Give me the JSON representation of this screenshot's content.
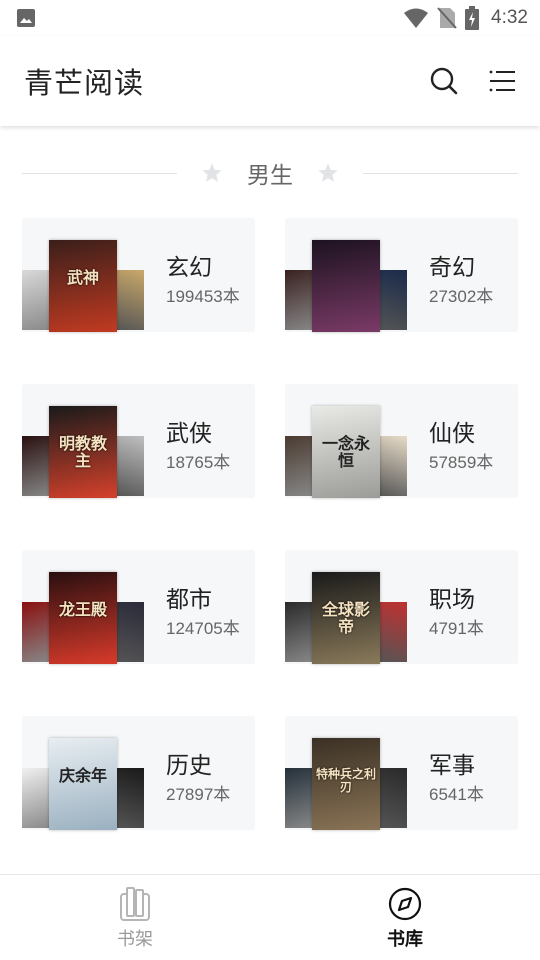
{
  "status_bar": {
    "time": "4:32"
  },
  "app": {
    "title": "青芒阅读"
  },
  "section": {
    "title": "男生"
  },
  "categories": [
    {
      "name": "玄幻",
      "count": "199453本",
      "cover_text": "武神",
      "cover_colors": [
        "#3a1f1a",
        "#c23a21"
      ],
      "side_colors": [
        "#d9d9d9",
        "#c9a86a"
      ]
    },
    {
      "name": "奇幻",
      "count": "27302本",
      "cover_text": "",
      "cover_colors": [
        "#1c1220",
        "#7a3a66"
      ],
      "side_colors": [
        "#3a2020",
        "#1a2a4a"
      ]
    },
    {
      "name": "武侠",
      "count": "18765本",
      "cover_text": "明教教主",
      "cover_colors": [
        "#1a1a1a",
        "#d5412b"
      ],
      "side_colors": [
        "#2a1010",
        "#bfbfbf"
      ]
    },
    {
      "name": "仙侠",
      "count": "57859本",
      "cover_text": "一念永恒",
      "cover_colors": [
        "#e9e9e6",
        "#9b9b98"
      ],
      "side_colors": [
        "#4a3a30",
        "#e8dcc8"
      ]
    },
    {
      "name": "都市",
      "count": "124705本",
      "cover_text": "龙王殿",
      "cover_colors": [
        "#2a0f10",
        "#d83a2a"
      ],
      "side_colors": [
        "#8a1010",
        "#2a2a3a"
      ]
    },
    {
      "name": "职场",
      "count": "4791本",
      "cover_text": "全球影帝",
      "cover_colors": [
        "#1a1a1a",
        "#8a7a5a"
      ],
      "side_colors": [
        "#2a2a2a",
        "#c03030"
      ]
    },
    {
      "name": "历史",
      "count": "27897本",
      "cover_text": "庆余年",
      "cover_colors": [
        "#e8eef2",
        "#9ab0c0"
      ],
      "side_colors": [
        "#f0f0f0",
        "#1a1a1a"
      ]
    },
    {
      "name": "军事",
      "count": "6541本",
      "cover_text": "特种兵之利刃",
      "cover_colors": [
        "#3a3024",
        "#8a7456"
      ],
      "side_colors": [
        "#24303a",
        "#2a2a2a"
      ]
    }
  ],
  "bottom_nav": [
    {
      "label": "书架",
      "state": "inactive"
    },
    {
      "label": "书库",
      "state": "active"
    }
  ]
}
